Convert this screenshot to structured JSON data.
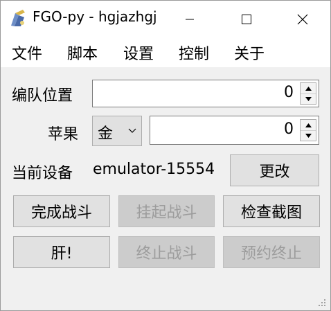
{
  "window": {
    "title": "FGO-py - hgjazhgj",
    "icon": "fgo-app-icon",
    "controls": [
      "minimize-icon",
      "maximize-icon",
      "close-icon"
    ]
  },
  "menu": {
    "items": [
      "文件",
      "脚本",
      "设置",
      "控制",
      "关于"
    ]
  },
  "form": {
    "team_position_label": "编队位置",
    "team_position_value": "0",
    "apple_label": "苹果",
    "apple_kind": "金",
    "apple_count": "0",
    "device_label": "当前设备",
    "device_value": "emulator-15554",
    "change_label": "更改"
  },
  "buttons": {
    "finish_battle": "完成战斗",
    "suspend_battle": "挂起战斗",
    "check_screenshot": "检查截图",
    "run": "肝!",
    "stop_battle": "终止战斗",
    "schedule_stop": "预约终止"
  },
  "colors": {
    "window_bg": "#f0f0f0",
    "button_bg": "#e1e1e1",
    "disabled_text": "#9c9c9c"
  }
}
